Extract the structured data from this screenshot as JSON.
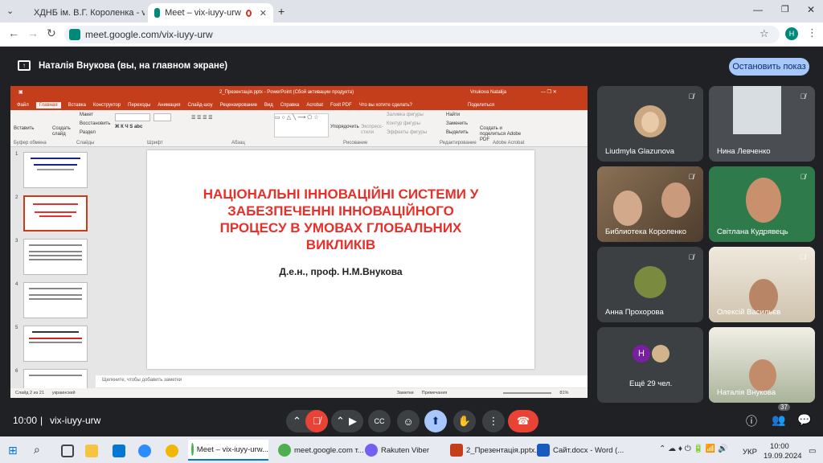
{
  "browser": {
    "tabs": [
      {
        "label": "ХДНБ ім. В.Г. Короленка - vnnn"
      },
      {
        "label": "Meet – vix-iuyy-urw"
      }
    ],
    "url": "meet.google.com/vix-iuyy-urw",
    "profile_initial": "Н"
  },
  "meet": {
    "presenting_text": "Наталія Внукова (вы, на главном экране)",
    "stop_button": "Остановить показ",
    "time": "10:00",
    "meeting_code": "vix-iuyy-urw",
    "participants_count": "37",
    "accent": "#a8c7fa",
    "hangup_color": "#ea4335"
  },
  "ppt": {
    "title": "2_Презентація.pptx - PowerPoint (Сбой активации продукта)",
    "user": "Vnukova Natalija",
    "menu": [
      "Файл",
      "Главная",
      "Вставка",
      "Конструктор",
      "Переходы",
      "Анимация",
      "Слайд-шоу",
      "Рецензирование",
      "Вид",
      "Справка",
      "Acrobat",
      "Foxit PDF",
      "Что вы хотите сделать?",
      "Поделиться"
    ],
    "ribbon_groups": [
      "Буфер обмена",
      "Слайды",
      "Шрифт",
      "Абзац",
      "Рисование",
      "Редактирование",
      "Adobe Acrobat"
    ],
    "ribbon_labels": {
      "paste": "Вставить",
      "create": "Создать слайд",
      "layout": "Макет",
      "reset": "Восстановить",
      "section": "Раздел",
      "arrange": "Упорядочить",
      "styles": "Экспресс-стили",
      "fill": "Заливка фигуры",
      "outline": "Контур фигуры",
      "effects": "Эффекты фигуры",
      "find": "Найти",
      "replace": "Заменить",
      "select": "Выделить",
      "acrobat": "Создать и поделиться Adobe PDF"
    },
    "slide_title": "НАЦІОНАЛЬНІ ІННОВАЦІЙНІ СИСТЕМИ У ЗАБЕЗПЕЧЕННІ ІННОВАЦІЙНОГО ПРОЦЕСУ В УМОВАХ ГЛОБАЛЬНИХ ВИКЛИКІВ",
    "slide_author": "Д.е.н., проф. Н.М.Внукова",
    "notes_placeholder": "Щелкните, чтобы добавить заметки",
    "status_slide": "Слайд 2 из 21",
    "status_lang": "украинский",
    "status_notes": "Заметки",
    "status_comments": "Примечания",
    "zoom": "81%",
    "thumb_numbers": [
      "1",
      "2",
      "3",
      "4",
      "5",
      "6"
    ]
  },
  "participants": [
    {
      "name": "Liudmyla Glazunova",
      "muted": true
    },
    {
      "name": "Нина Левченко",
      "muted": true
    },
    {
      "name": "Библиотека Короленко",
      "muted": true
    },
    {
      "name": "Світлана Кудрявець",
      "muted": true
    },
    {
      "name": "Анна Прохорова",
      "muted": true
    },
    {
      "name": "Олексій Васильєв",
      "muted": true
    },
    {
      "name": "Ещё 29 чел.",
      "muted": false
    },
    {
      "name": "Наталія Внукова",
      "muted": false
    }
  ],
  "more_initial": "Н",
  "taskbar": {
    "items": [
      {
        "label": "Meet – vix-iuyy-urw..."
      },
      {
        "label": "meet.google.com т..."
      },
      {
        "label": "Rakuten Viber"
      },
      {
        "label": "2_Презентація.pptx..."
      },
      {
        "label": "Сайт.docx - Word (..."
      }
    ],
    "lang": "УКР",
    "time": "10:00",
    "date": "19.09.2024"
  }
}
